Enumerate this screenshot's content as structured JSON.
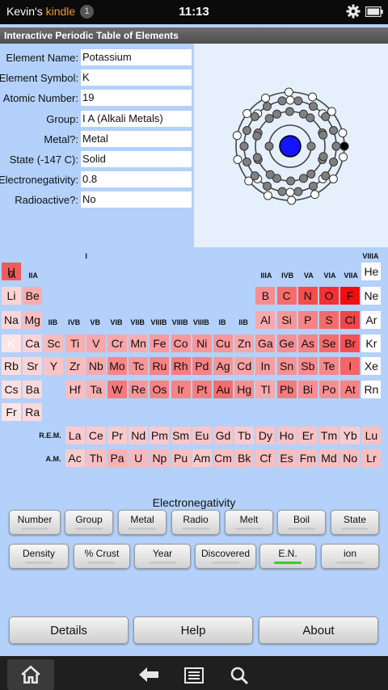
{
  "status": {
    "owner": "Kevin's",
    "device": "kindle",
    "notifications": "1",
    "time": "11:13"
  },
  "app": {
    "title": "Interactive Periodic Table of Elements"
  },
  "info": [
    {
      "label": "Element Name:",
      "value": "Potassium"
    },
    {
      "label": "Element Symbol:",
      "value": "K"
    },
    {
      "label": "Atomic Number:",
      "value": "19"
    },
    {
      "label": "Group:",
      "value": "I A (Alkali Metals)"
    },
    {
      "label": "Metal?:",
      "value": "Metal"
    },
    {
      "label": "State (-147 C):",
      "value": "Solid"
    },
    {
      "label": "Electronegativity:",
      "value": "0.8"
    },
    {
      "label": "Radioactive?:",
      "value": "No"
    }
  ],
  "atom": {
    "shell_electrons": [
      2,
      8,
      8,
      1
    ],
    "nucleus_color": "#1414ff"
  },
  "group_labels": {
    "top": [
      "I",
      "VIIIA"
    ],
    "second": [
      "IA",
      "IIA",
      "IIIA",
      "IVB",
      "VA",
      "VIA",
      "VIIA"
    ],
    "transition": [
      "IIB",
      "IVB",
      "VB",
      "VIB",
      "VIIB",
      "VIIIB",
      "VIIIB",
      "VIIIB",
      "IB",
      "IIB"
    ],
    "series": [
      "R.E.M.",
      "A.M."
    ]
  },
  "elements": {
    "main": [
      [
        "H",
        "",
        "",
        "",
        "",
        "",
        "",
        "",
        "",
        "",
        "",
        "",
        "",
        "",
        "",
        "",
        "",
        "He"
      ],
      [
        "Li",
        "Be",
        "",
        "",
        "",
        "",
        "",
        "",
        "",
        "",
        "",
        "",
        "B",
        "C",
        "N",
        "O",
        "F",
        "Ne"
      ],
      [
        "Na",
        "Mg",
        "",
        "",
        "",
        "",
        "",
        "",
        "",
        "",
        "",
        "",
        "Al",
        "Si",
        "P",
        "S",
        "Cl",
        "Ar"
      ],
      [
        "K",
        "Ca",
        "Sc",
        "Ti",
        "V",
        "Cr",
        "Mn",
        "Fe",
        "Co",
        "Ni",
        "Cu",
        "Zn",
        "Ga",
        "Ge",
        "As",
        "Se",
        "Br",
        "Kr"
      ],
      [
        "Rb",
        "Sr",
        "Y",
        "Zr",
        "Nb",
        "Mo",
        "Tc",
        "Ru",
        "Rh",
        "Pd",
        "Ag",
        "Cd",
        "In",
        "Sn",
        "Sb",
        "Te",
        "I",
        "Xe"
      ],
      [
        "Cs",
        "Ba",
        "",
        "Hf",
        "Ta",
        "W",
        "Re",
        "Os",
        "Ir",
        "Pt",
        "Au",
        "Hg",
        "Tl",
        "Pb",
        "Bi",
        "Po",
        "At",
        "Rn"
      ],
      [
        "Fr",
        "Ra",
        "",
        "",
        "",
        "",
        "",
        "",
        "",
        "",
        "",
        "",
        "",
        "",
        "",
        "",
        "",
        ""
      ]
    ],
    "lanthanides": [
      "La",
      "Ce",
      "Pr",
      "Nd",
      "Pm",
      "Sm",
      "Eu",
      "Gd",
      "Tb",
      "Dy",
      "Ho",
      "Er",
      "Tm",
      "Yb",
      "Lu"
    ],
    "actinides": [
      "Ac",
      "Th",
      "Pa",
      "U",
      "Np",
      "Pu",
      "Am",
      "Cm",
      "Bk",
      "Cf",
      "Es",
      "Fm",
      "Md",
      "No",
      "Lr"
    ],
    "selected": "K",
    "electronegativity": {
      "H": 2.2,
      "Li": 0.98,
      "Be": 1.57,
      "B": 2.04,
      "C": 2.55,
      "N": 3.04,
      "O": 3.44,
      "F": 3.98,
      "Na": 0.93,
      "Mg": 1.31,
      "Al": 1.61,
      "Si": 1.9,
      "P": 2.19,
      "S": 2.58,
      "Cl": 3.16,
      "K": 0.82,
      "Ca": 1.0,
      "Sc": 1.36,
      "Ti": 1.54,
      "V": 1.63,
      "Cr": 1.66,
      "Mn": 1.55,
      "Fe": 1.83,
      "Co": 1.88,
      "Ni": 1.91,
      "Cu": 1.9,
      "Zn": 1.65,
      "Ga": 1.81,
      "Ge": 2.01,
      "As": 2.18,
      "Se": 2.55,
      "Br": 2.96,
      "Kr": 3.0,
      "Rb": 0.82,
      "Sr": 0.95,
      "Y": 1.22,
      "Zr": 1.33,
      "Nb": 1.6,
      "Mo": 2.16,
      "Tc": 1.9,
      "Ru": 2.2,
      "Rh": 2.28,
      "Pd": 2.2,
      "Ag": 1.93,
      "Cd": 1.69,
      "In": 1.78,
      "Sn": 1.96,
      "Sb": 2.05,
      "Te": 2.1,
      "I": 2.66,
      "Xe": 2.6,
      "Cs": 0.79,
      "Ba": 0.89,
      "Hf": 1.3,
      "Ta": 1.5,
      "W": 2.36,
      "Re": 1.9,
      "Os": 2.2,
      "Ir": 2.2,
      "Pt": 2.28,
      "Au": 2.54,
      "Hg": 2.0,
      "Tl": 1.62,
      "Pb": 2.33,
      "Bi": 2.02,
      "Po": 2.0,
      "At": 2.2,
      "Fr": 0.7,
      "Ra": 0.9,
      "La": 1.1,
      "Ce": 1.12,
      "Pr": 1.13,
      "Nd": 1.14,
      "Pm": 1.13,
      "Sm": 1.17,
      "Eu": 1.2,
      "Gd": 1.2,
      "Tb": 1.1,
      "Dy": 1.22,
      "Ho": 1.23,
      "Er": 1.24,
      "Tm": 1.25,
      "Yb": 1.1,
      "Lu": 1.27,
      "Ac": 1.1,
      "Th": 1.3,
      "Pa": 1.5,
      "U": 1.38,
      "Np": 1.36,
      "Pu": 1.28,
      "Am": 1.13,
      "Cm": 1.28,
      "Bk": 1.3,
      "Cf": 1.3,
      "Es": 1.3,
      "Fm": 1.3,
      "Md": 1.3,
      "No": 1.3,
      "Lr": 1.3
    }
  },
  "colors": {
    "low": "#fbe5e8",
    "high": "#f20e0e",
    "background": "#b3d1fa",
    "active_indicator": "#2fd41f"
  },
  "property_label": "Electronegativity",
  "property_buttons": {
    "row1": [
      "Number",
      "Group",
      "Metal",
      "Radio",
      "Melt",
      "Boil",
      "State"
    ],
    "row2": [
      "Density",
      "% Crust",
      "Year",
      "Discovered",
      "E.N.",
      "ion"
    ],
    "active": "E.N."
  },
  "bottom_buttons": [
    "Details",
    "Help",
    "About"
  ],
  "nav": {
    "icons": [
      "home-icon",
      "back-icon",
      "menu-icon",
      "search-icon"
    ]
  }
}
